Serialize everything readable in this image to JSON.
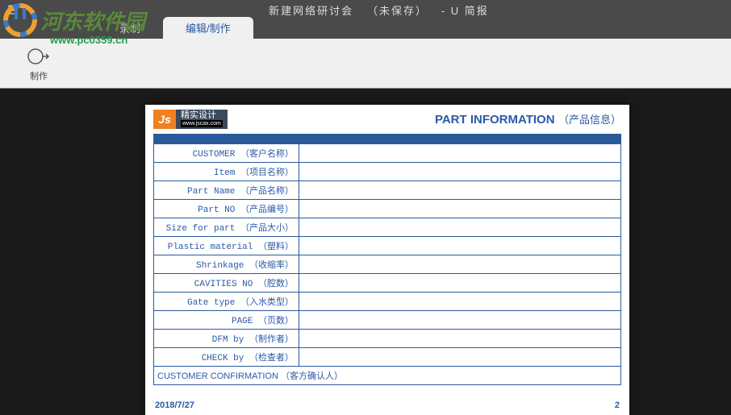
{
  "titleBar": {
    "docName": "新建网络研讨会",
    "status": "（未保存）",
    "appName": "- U 简报"
  },
  "tabs": {
    "record": "录制",
    "edit": "编辑/制作"
  },
  "ribbon": {
    "produce": "制作"
  },
  "watermark": {
    "siteName": "河东软件园",
    "url": "www.pc0359.cn"
  },
  "document": {
    "logoCn": "精实设计",
    "logoUrl": "www.jscax.com",
    "title": "PART INFORMATION",
    "titleCn": "（产品信息）",
    "rows": [
      {
        "en": "CUSTOMER",
        "cn": "（客户名称）"
      },
      {
        "en": "Item",
        "cn": "（项目名称）"
      },
      {
        "en": "Part Name",
        "cn": "（产品名称）"
      },
      {
        "en": "Part NO",
        "cn": "（产品编号）"
      },
      {
        "en": "Size for part",
        "cn": "（产品大小）"
      },
      {
        "en": "Plastic material",
        "cn": "（塑料）"
      },
      {
        "en": "Shrinkage",
        "cn": "（收缩率）"
      },
      {
        "en": "CAVITIES NO",
        "cn": "（腔数）"
      },
      {
        "en": "Gate type",
        "cn": "（入水类型）"
      },
      {
        "en": "PAGE",
        "cn": "（页数）"
      },
      {
        "en": "DFM by",
        "cn": "（制作者）"
      },
      {
        "en": "CHECK by",
        "cn": "（检查者）"
      }
    ],
    "confirmRow": {
      "en": "CUSTOMER CONFIRMATION",
      "cn": "（客方确认人）"
    },
    "footerDate": "2018/7/27",
    "footerPage": "2"
  }
}
